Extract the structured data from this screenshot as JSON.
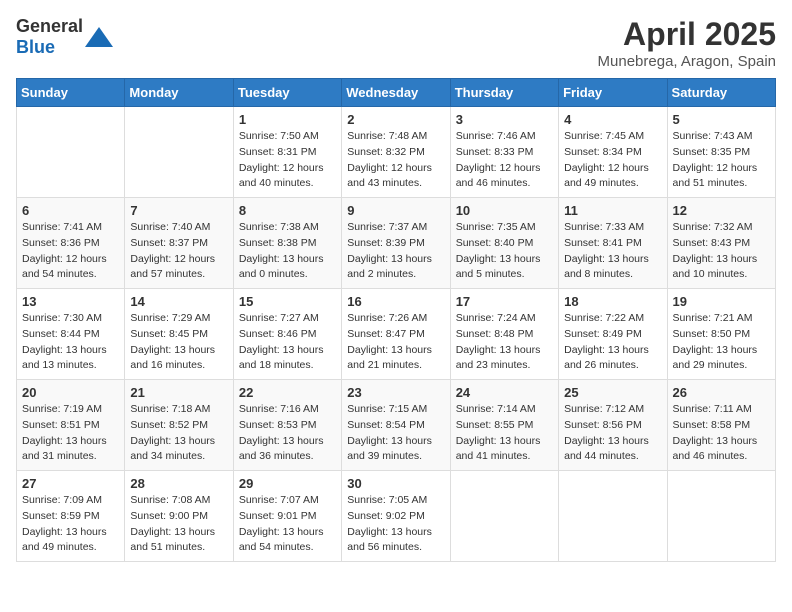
{
  "header": {
    "logo_general": "General",
    "logo_blue": "Blue",
    "month_year": "April 2025",
    "location": "Munebrega, Aragon, Spain"
  },
  "calendar": {
    "days_of_week": [
      "Sunday",
      "Monday",
      "Tuesday",
      "Wednesday",
      "Thursday",
      "Friday",
      "Saturday"
    ],
    "weeks": [
      [
        {
          "day": "",
          "info": ""
        },
        {
          "day": "",
          "info": ""
        },
        {
          "day": "1",
          "info": "Sunrise: 7:50 AM\nSunset: 8:31 PM\nDaylight: 12 hours and 40 minutes."
        },
        {
          "day": "2",
          "info": "Sunrise: 7:48 AM\nSunset: 8:32 PM\nDaylight: 12 hours and 43 minutes."
        },
        {
          "day": "3",
          "info": "Sunrise: 7:46 AM\nSunset: 8:33 PM\nDaylight: 12 hours and 46 minutes."
        },
        {
          "day": "4",
          "info": "Sunrise: 7:45 AM\nSunset: 8:34 PM\nDaylight: 12 hours and 49 minutes."
        },
        {
          "day": "5",
          "info": "Sunrise: 7:43 AM\nSunset: 8:35 PM\nDaylight: 12 hours and 51 minutes."
        }
      ],
      [
        {
          "day": "6",
          "info": "Sunrise: 7:41 AM\nSunset: 8:36 PM\nDaylight: 12 hours and 54 minutes."
        },
        {
          "day": "7",
          "info": "Sunrise: 7:40 AM\nSunset: 8:37 PM\nDaylight: 12 hours and 57 minutes."
        },
        {
          "day": "8",
          "info": "Sunrise: 7:38 AM\nSunset: 8:38 PM\nDaylight: 13 hours and 0 minutes."
        },
        {
          "day": "9",
          "info": "Sunrise: 7:37 AM\nSunset: 8:39 PM\nDaylight: 13 hours and 2 minutes."
        },
        {
          "day": "10",
          "info": "Sunrise: 7:35 AM\nSunset: 8:40 PM\nDaylight: 13 hours and 5 minutes."
        },
        {
          "day": "11",
          "info": "Sunrise: 7:33 AM\nSunset: 8:41 PM\nDaylight: 13 hours and 8 minutes."
        },
        {
          "day": "12",
          "info": "Sunrise: 7:32 AM\nSunset: 8:43 PM\nDaylight: 13 hours and 10 minutes."
        }
      ],
      [
        {
          "day": "13",
          "info": "Sunrise: 7:30 AM\nSunset: 8:44 PM\nDaylight: 13 hours and 13 minutes."
        },
        {
          "day": "14",
          "info": "Sunrise: 7:29 AM\nSunset: 8:45 PM\nDaylight: 13 hours and 16 minutes."
        },
        {
          "day": "15",
          "info": "Sunrise: 7:27 AM\nSunset: 8:46 PM\nDaylight: 13 hours and 18 minutes."
        },
        {
          "day": "16",
          "info": "Sunrise: 7:26 AM\nSunset: 8:47 PM\nDaylight: 13 hours and 21 minutes."
        },
        {
          "day": "17",
          "info": "Sunrise: 7:24 AM\nSunset: 8:48 PM\nDaylight: 13 hours and 23 minutes."
        },
        {
          "day": "18",
          "info": "Sunrise: 7:22 AM\nSunset: 8:49 PM\nDaylight: 13 hours and 26 minutes."
        },
        {
          "day": "19",
          "info": "Sunrise: 7:21 AM\nSunset: 8:50 PM\nDaylight: 13 hours and 29 minutes."
        }
      ],
      [
        {
          "day": "20",
          "info": "Sunrise: 7:19 AM\nSunset: 8:51 PM\nDaylight: 13 hours and 31 minutes."
        },
        {
          "day": "21",
          "info": "Sunrise: 7:18 AM\nSunset: 8:52 PM\nDaylight: 13 hours and 34 minutes."
        },
        {
          "day": "22",
          "info": "Sunrise: 7:16 AM\nSunset: 8:53 PM\nDaylight: 13 hours and 36 minutes."
        },
        {
          "day": "23",
          "info": "Sunrise: 7:15 AM\nSunset: 8:54 PM\nDaylight: 13 hours and 39 minutes."
        },
        {
          "day": "24",
          "info": "Sunrise: 7:14 AM\nSunset: 8:55 PM\nDaylight: 13 hours and 41 minutes."
        },
        {
          "day": "25",
          "info": "Sunrise: 7:12 AM\nSunset: 8:56 PM\nDaylight: 13 hours and 44 minutes."
        },
        {
          "day": "26",
          "info": "Sunrise: 7:11 AM\nSunset: 8:58 PM\nDaylight: 13 hours and 46 minutes."
        }
      ],
      [
        {
          "day": "27",
          "info": "Sunrise: 7:09 AM\nSunset: 8:59 PM\nDaylight: 13 hours and 49 minutes."
        },
        {
          "day": "28",
          "info": "Sunrise: 7:08 AM\nSunset: 9:00 PM\nDaylight: 13 hours and 51 minutes."
        },
        {
          "day": "29",
          "info": "Sunrise: 7:07 AM\nSunset: 9:01 PM\nDaylight: 13 hours and 54 minutes."
        },
        {
          "day": "30",
          "info": "Sunrise: 7:05 AM\nSunset: 9:02 PM\nDaylight: 13 hours and 56 minutes."
        },
        {
          "day": "",
          "info": ""
        },
        {
          "day": "",
          "info": ""
        },
        {
          "day": "",
          "info": ""
        }
      ]
    ]
  }
}
